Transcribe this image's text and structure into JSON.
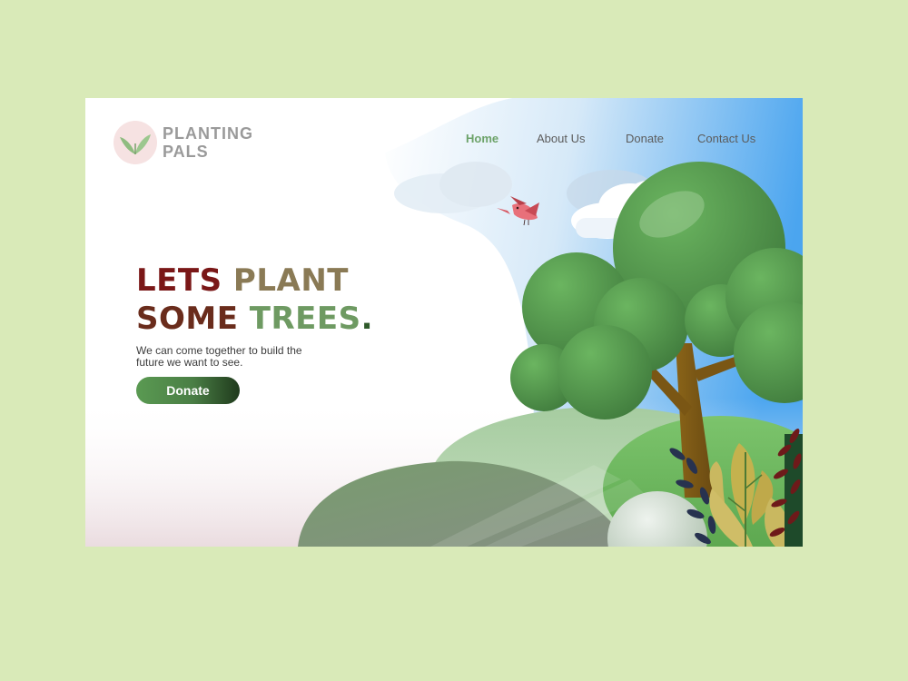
{
  "brand": {
    "line1": "PLANTING",
    "line2": "PALS"
  },
  "nav": {
    "items": [
      {
        "label": "Home",
        "active": true
      },
      {
        "label": "About Us",
        "active": false
      },
      {
        "label": "Donate",
        "active": false
      },
      {
        "label": "Contact Us",
        "active": false
      }
    ]
  },
  "hero": {
    "headline_line1_word1": "LETS",
    "headline_line1_word2": "PLANT",
    "headline_line2_word1": "SOME",
    "headline_line2_word2": "TREES",
    "headline_line2_word3": ".",
    "subtitle": "We can come together to build the future we want to see.",
    "cta_label": "Donate"
  },
  "colors": {
    "page_background": "#d9eab8",
    "nav_active": "#6da36a",
    "button_start": "#5a9a52",
    "button_end": "#1f3a1c",
    "sky": "#5aaaf0"
  },
  "icons": {
    "logo": "leaf-icon",
    "bird": "bird-icon"
  }
}
